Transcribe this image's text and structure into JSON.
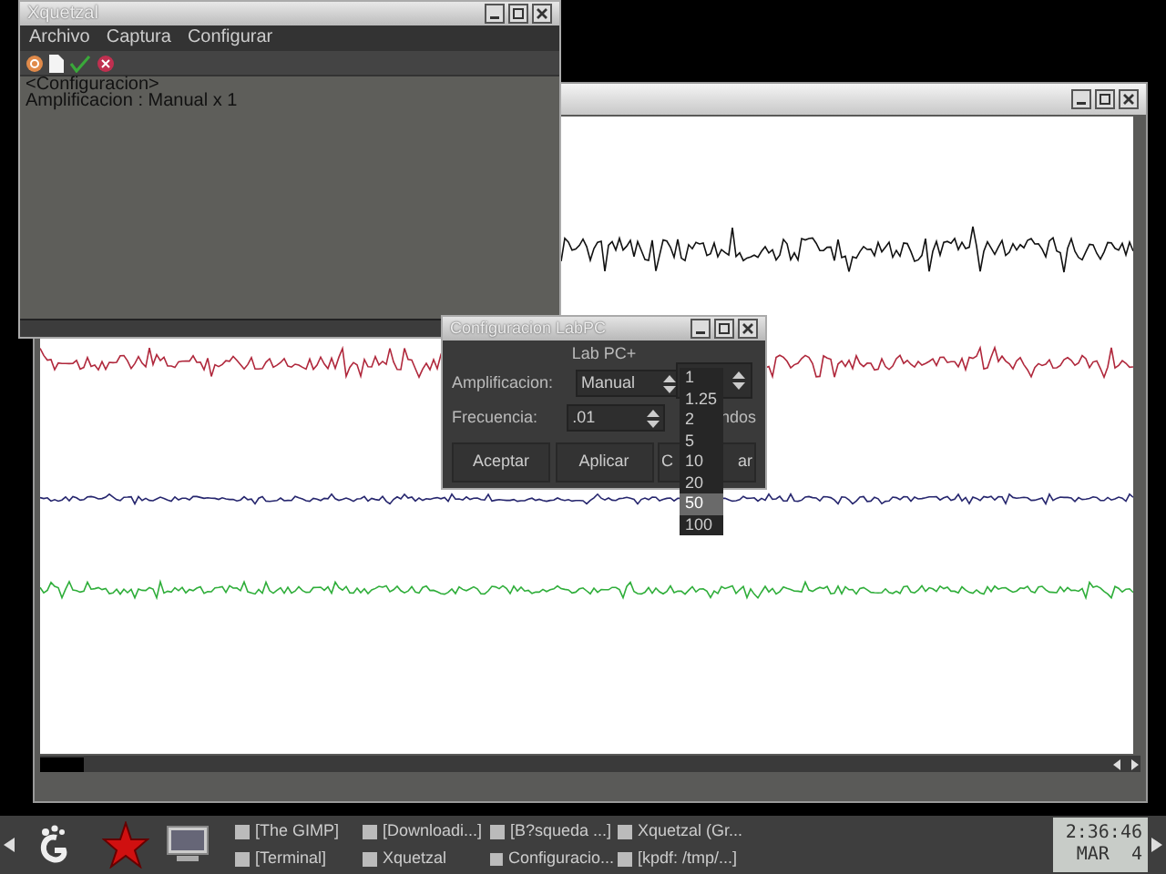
{
  "plot_window": {
    "traces": [
      {
        "color": "#111111"
      },
      {
        "color": "#b0283c"
      },
      {
        "color": "#26266e"
      },
      {
        "color": "#2fae3a"
      }
    ]
  },
  "xquetzal_window": {
    "title": "Xquetzal",
    "menu": [
      "Archivo",
      "Captura",
      "Configurar"
    ],
    "lines": [
      "<Configuracion>",
      "Amplificacion : Manual x 1"
    ]
  },
  "dialog": {
    "title": "Configuracion LabPC",
    "group_label": "Lab PC+",
    "fields": [
      {
        "label": "Amplificacion:",
        "value": "Manual"
      },
      {
        "label": "Frecuencia:",
        "value": ".01"
      }
    ],
    "unit_fragment": "ndos",
    "buttons": [
      {
        "parts": [
          "Aceptar"
        ]
      },
      {
        "parts": [
          "Aplicar"
        ]
      },
      {
        "parts": [
          "C",
          "ar"
        ]
      }
    ],
    "dropdown": {
      "options": [
        {
          "label": "1",
          "selected": false
        },
        {
          "label": "1.25",
          "selected": false
        },
        {
          "label": "2",
          "selected": false
        },
        {
          "label": "5",
          "selected": false
        },
        {
          "label": "10",
          "selected": false
        },
        {
          "label": "20",
          "selected": false
        },
        {
          "label": "50",
          "selected": true
        },
        {
          "label": "100",
          "selected": false
        }
      ]
    }
  },
  "taskbar": {
    "tasks": [
      {
        "label": "[The GIMP]"
      },
      {
        "label": "[Downloadi...]"
      },
      {
        "label": "[B?squeda ...]"
      },
      {
        "label": "Xquetzal (Gr..."
      },
      {
        "label": "[Terminal]"
      },
      {
        "label": "Xquetzal"
      },
      {
        "label": "Configuracio..."
      },
      {
        "label": "[kpdf: /tmp/...]"
      }
    ],
    "clock": {
      "time": "2:36:46",
      "date": "MAR  4"
    }
  }
}
